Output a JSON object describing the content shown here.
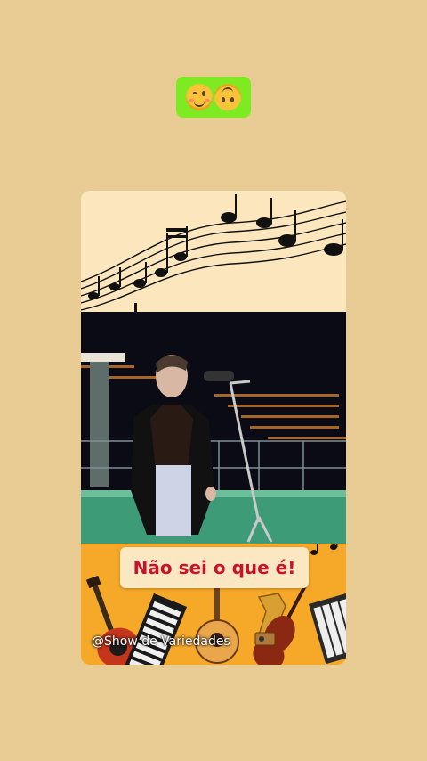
{
  "reaction": {
    "icons": [
      "face-with-tongue-wink-emoji",
      "upside-down-face-emoji"
    ],
    "background": "#7eea22"
  },
  "post": {
    "caption": "Não sei o que é!",
    "watermark": "@Show de Variedades",
    "caption_color": "#c8142a",
    "icons": [
      "music-notes-staff",
      "electric-guitar-icon",
      "keyboard-icon",
      "acoustic-guitar-icon",
      "saxophone-icon",
      "violin-icon",
      "radio-icon"
    ]
  },
  "page": {
    "background": "#e8cc94"
  }
}
